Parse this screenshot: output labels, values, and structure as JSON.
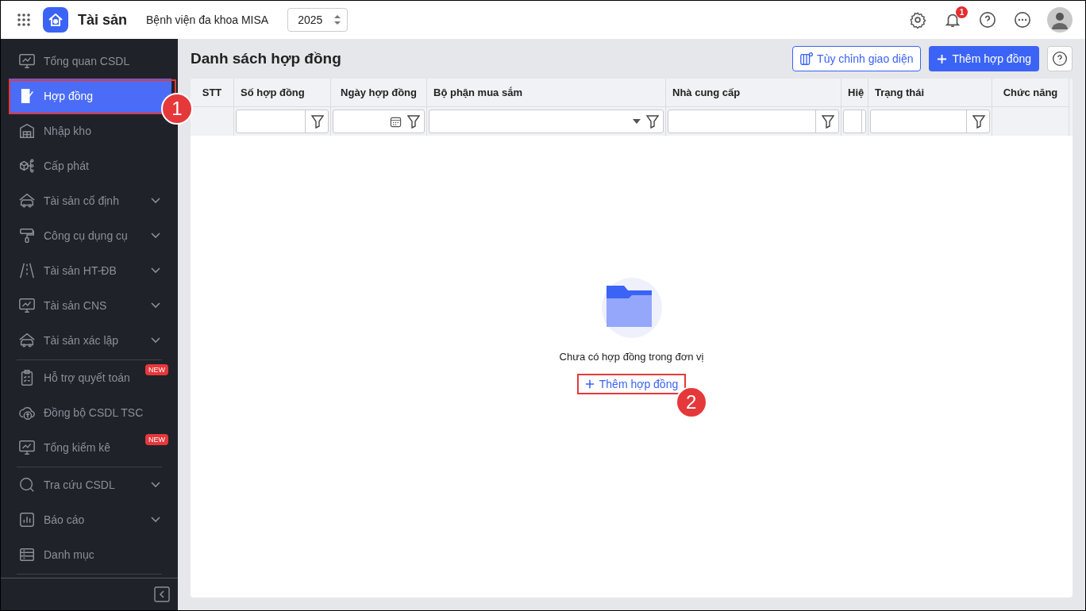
{
  "topbar": {
    "app_name": "Tài sản",
    "organization": "Bệnh viện đa khoa MISA",
    "year": "2025",
    "notification_count": "1"
  },
  "sidebar": {
    "sections": [
      [
        {
          "label": "Tổng quan CSDL",
          "kind": "link",
          "selected": false
        },
        {
          "label": "Hợp đồng",
          "kind": "link",
          "selected": true
        },
        {
          "label": "Nhập kho",
          "kind": "link",
          "selected": false
        },
        {
          "label": "Cấp phát",
          "kind": "link",
          "selected": false
        },
        {
          "label": "Tài sản cố định",
          "kind": "group",
          "selected": false
        },
        {
          "label": "Công cụ dụng cụ",
          "kind": "group",
          "selected": false
        },
        {
          "label": "Tài sản HT-ĐB",
          "kind": "group",
          "selected": false
        },
        {
          "label": "Tài sản CNS",
          "kind": "group",
          "selected": false
        },
        {
          "label": "Tài sản xác lập",
          "kind": "group",
          "selected": false
        }
      ],
      [
        {
          "label": "Hỗ trợ quyết toán",
          "kind": "link",
          "selected": false,
          "badge": "NEW"
        },
        {
          "label": "Đồng bộ CSDL TSC",
          "kind": "link",
          "selected": false
        },
        {
          "label": "Tổng kiểm kê",
          "kind": "link",
          "selected": false,
          "badge": "NEW"
        }
      ],
      [
        {
          "label": "Tra cứu CSDL",
          "kind": "group",
          "selected": false
        },
        {
          "label": "Báo cáo",
          "kind": "group",
          "selected": false
        },
        {
          "label": "Danh mục",
          "kind": "link",
          "selected": false
        }
      ]
    ]
  },
  "page": {
    "title": "Danh sách hợp đồng",
    "customize_button": "Tùy chỉnh giao diện",
    "add_button": "Thêm hợp đồng"
  },
  "table": {
    "columns": [
      {
        "label": "STT",
        "kind": "plain"
      },
      {
        "label": "Số hợp đồng",
        "kind": "text"
      },
      {
        "label": "Ngày hợp đồng",
        "kind": "date"
      },
      {
        "label": "Bộ phận mua sắm",
        "kind": "select"
      },
      {
        "label": "Nhà cung cấp",
        "kind": "text"
      },
      {
        "label": "Hiệ",
        "kind": "text"
      },
      {
        "label": "Trạng thái",
        "kind": "text"
      },
      {
        "label": "Chức năng",
        "kind": "plain"
      }
    ],
    "empty_message": "Chưa có hợp đồng trong đơn vị",
    "empty_action": "Thêm hợp đồng"
  },
  "callouts": [
    {
      "label": "1"
    },
    {
      "label": "2"
    }
  ]
}
